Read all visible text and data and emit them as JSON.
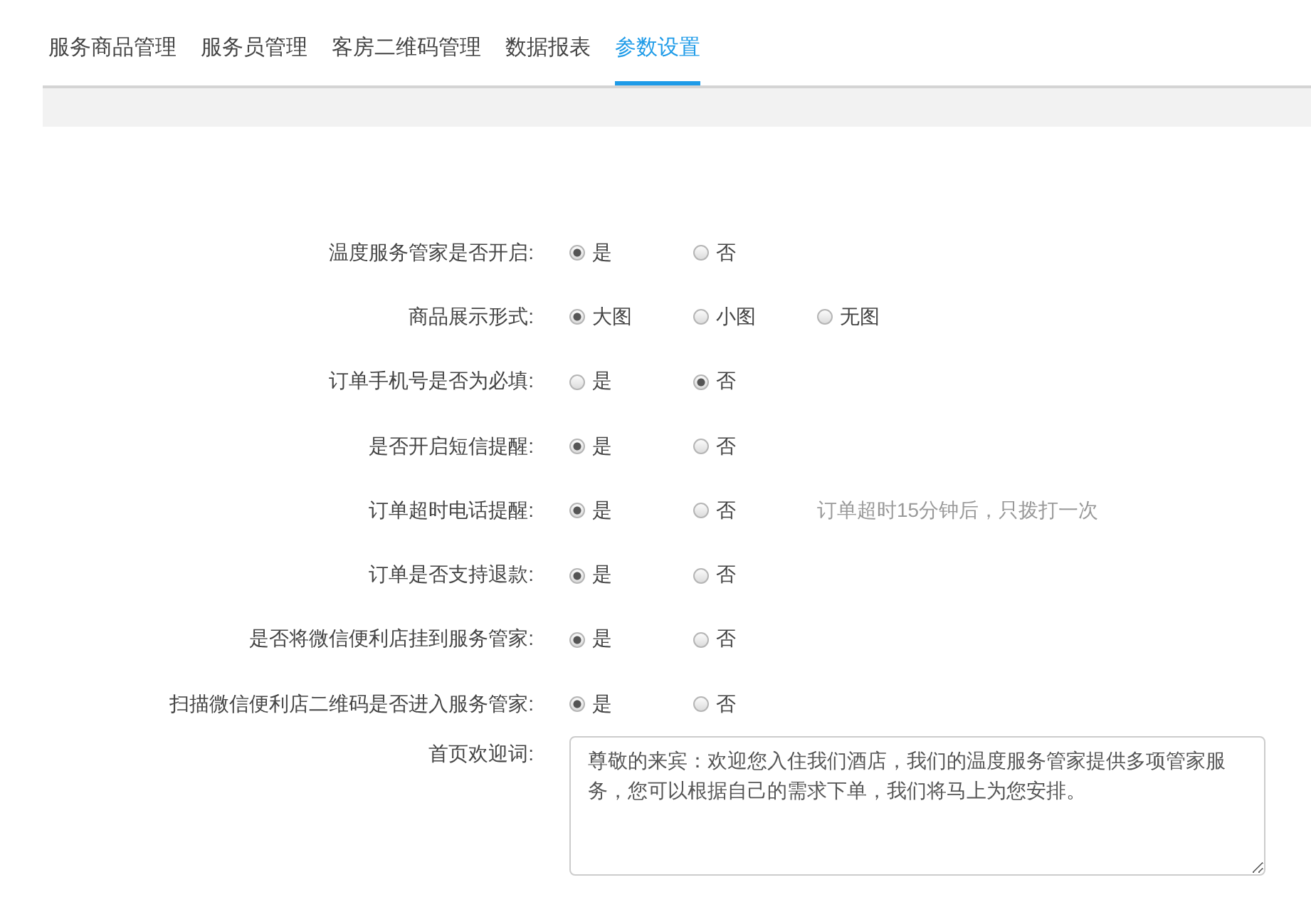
{
  "tabs": [
    {
      "label": "服务商品管理",
      "selected": false
    },
    {
      "label": "服务员管理",
      "selected": false
    },
    {
      "label": "客房二维码管理",
      "selected": false
    },
    {
      "label": "数据报表",
      "selected": false
    },
    {
      "label": "参数设置",
      "selected": true
    }
  ],
  "settings": [
    {
      "kind": "radio",
      "label": "温度服务管家是否开启:",
      "options": [
        {
          "label": "是",
          "selected": true
        },
        {
          "label": "否",
          "selected": false
        }
      ]
    },
    {
      "kind": "radio",
      "label": "商品展示形式:",
      "options": [
        {
          "label": "大图",
          "selected": true
        },
        {
          "label": "小图",
          "selected": false
        },
        {
          "label": "无图",
          "selected": false
        }
      ]
    },
    {
      "kind": "radio",
      "label": "订单手机号是否为必填:",
      "options": [
        {
          "label": "是",
          "selected": false
        },
        {
          "label": "否",
          "selected": true
        }
      ]
    },
    {
      "kind": "radio",
      "label": "是否开启短信提醒:",
      "options": [
        {
          "label": "是",
          "selected": true
        },
        {
          "label": "否",
          "selected": false
        }
      ]
    },
    {
      "kind": "radio",
      "label": "订单超时电话提醒:",
      "options": [
        {
          "label": "是",
          "selected": true
        },
        {
          "label": "否",
          "selected": false
        }
      ],
      "hint": "订单超时15分钟后，只拨打一次"
    },
    {
      "kind": "radio",
      "label": "订单是否支持退款:",
      "options": [
        {
          "label": "是",
          "selected": true
        },
        {
          "label": "否",
          "selected": false
        }
      ]
    },
    {
      "kind": "radio",
      "label": "是否将微信便利店挂到服务管家:",
      "options": [
        {
          "label": "是",
          "selected": true
        },
        {
          "label": "否",
          "selected": false
        }
      ]
    },
    {
      "kind": "radio",
      "label": "扫描微信便利店二维码是否进入服务管家:",
      "options": [
        {
          "label": "是",
          "selected": true
        },
        {
          "label": "否",
          "selected": false
        }
      ]
    },
    {
      "kind": "textarea",
      "label": "首页欢迎词:",
      "value": "尊敬的来宾：欢迎您入住我们酒店，我们的温度服务管家提供多项管家服务，您可以根据自己的需求下单，我们将马上为您安排。"
    }
  ]
}
